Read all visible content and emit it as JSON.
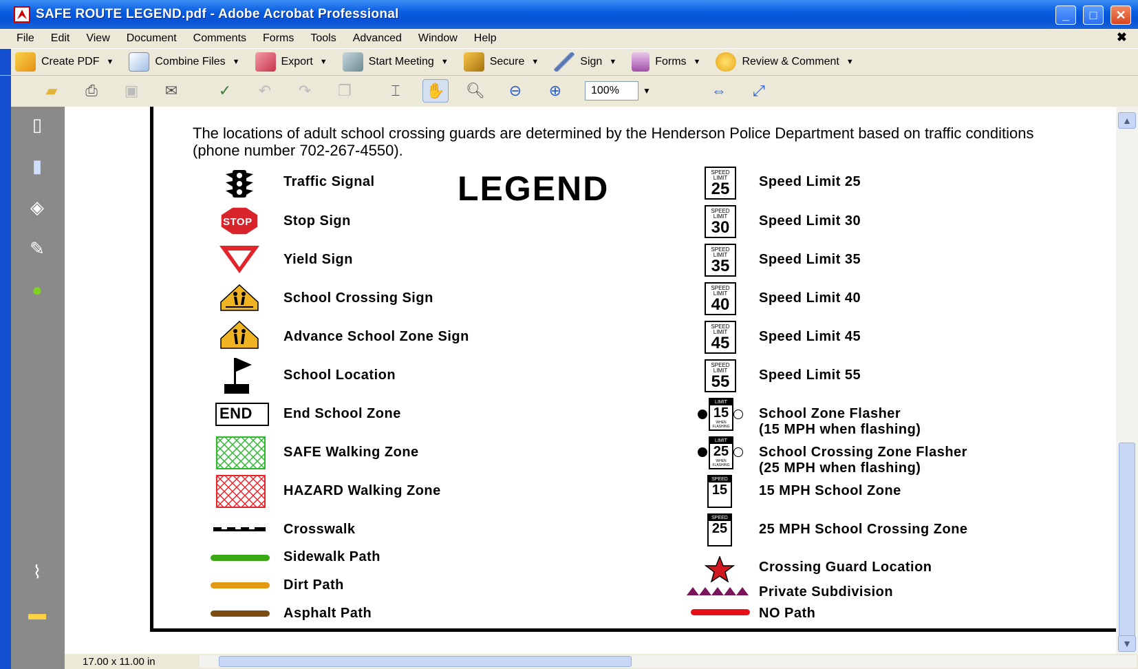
{
  "window": {
    "title": "SAFE ROUTE LEGEND.pdf - Adobe Acrobat Professional",
    "controls": {
      "minimize": "_",
      "maximize": "□",
      "close": "✕"
    }
  },
  "menu": [
    "File",
    "Edit",
    "View",
    "Document",
    "Comments",
    "Forms",
    "Tools",
    "Advanced",
    "Window",
    "Help"
  ],
  "menu_close": "✖",
  "tasks_toolbar": [
    {
      "label": "Create PDF",
      "icon": "create-pdf-icon"
    },
    {
      "label": "Combine Files",
      "icon": "combine-files-icon"
    },
    {
      "label": "Export",
      "icon": "export-icon"
    },
    {
      "label": "Start Meeting",
      "icon": "start-meeting-icon"
    },
    {
      "label": "Secure",
      "icon": "lock-icon"
    },
    {
      "label": "Sign",
      "icon": "pen-icon"
    },
    {
      "label": "Forms",
      "icon": "forms-icon"
    },
    {
      "label": "Review & Comment",
      "icon": "comment-cloud-icon"
    }
  ],
  "zoom": "100%",
  "document": {
    "intro": "The locations of adult school crossing guards are determined by the Henderson Police Department based on traffic conditions (phone number 702-267-4550).",
    "legend_title": "LEGEND",
    "left_items": [
      {
        "label": "Traffic Signal",
        "icon": "traffic-signal-icon"
      },
      {
        "label": "Stop Sign",
        "icon": "stop-sign-icon",
        "sign_text": "STOP"
      },
      {
        "label": "Yield Sign",
        "icon": "yield-sign-icon"
      },
      {
        "label": "School Crossing Sign",
        "icon": "school-crossing-sign-icon"
      },
      {
        "label": "Advance School Zone Sign",
        "icon": "advance-school-zone-sign-icon"
      },
      {
        "label": "School Location",
        "icon": "school-flag-icon"
      },
      {
        "label": "End School Zone",
        "icon": "end-school-zone-icon",
        "sign_text": "END"
      },
      {
        "label": "SAFE Walking Zone",
        "icon": "safe-zone-hatch-icon",
        "color": "#2fb82f"
      },
      {
        "label": "HAZARD Walking Zone",
        "icon": "hazard-zone-hatch-icon",
        "color": "#e8242a"
      },
      {
        "label": "Crosswalk",
        "icon": "crosswalk-icon"
      },
      {
        "label": "Sidewalk Path",
        "icon": "sidewalk-path-line",
        "color": "#3aa815"
      },
      {
        "label": "Dirt Path",
        "icon": "dirt-path-line",
        "color": "#e39a12"
      },
      {
        "label": "Asphalt Path",
        "icon": "asphalt-path-line",
        "color": "#7a4c10"
      }
    ],
    "right_items": [
      {
        "label": "Speed Limit 25",
        "sign_top": "SPEED LIMIT",
        "sign_num": "25"
      },
      {
        "label": "Speed Limit 30",
        "sign_top": "SPEED LIMIT",
        "sign_num": "30"
      },
      {
        "label": "Speed Limit 35",
        "sign_top": "SPEED LIMIT",
        "sign_num": "35"
      },
      {
        "label": "Speed Limit 40",
        "sign_top": "SPEED LIMIT",
        "sign_num": "40"
      },
      {
        "label": "Speed Limit 45",
        "sign_top": "SPEED LIMIT",
        "sign_num": "45"
      },
      {
        "label": "Speed Limit 55",
        "sign_top": "SPEED LIMIT",
        "sign_num": "55"
      },
      {
        "label": "School Zone Flasher",
        "label2": "(15 MPH when flashing)",
        "sign_top": "LIMIT",
        "sign_num": "15",
        "sign_bot": "WHEN FLASHING"
      },
      {
        "label": "School Crossing Zone Flasher",
        "label2": "(25 MPH when flashing)",
        "sign_top": "LIMIT",
        "sign_num": "25",
        "sign_bot": "WHEN FLASHING"
      },
      {
        "label": "15 MPH School Zone",
        "sign_top": "SPEED LIMIT",
        "sign_num": "15"
      },
      {
        "label": "25 MPH School Crossing Zone",
        "sign_top": "SPEED LIMIT",
        "sign_num": "25"
      },
      {
        "label": "Crossing Guard Location",
        "icon": "star-icon",
        "color": "#d0181e"
      },
      {
        "label": "Private Subdivision",
        "icon": "triangle-row-icon",
        "color": "#7a145a"
      },
      {
        "label": "NO Path",
        "icon": "no-path-line",
        "color": "#e5101a"
      }
    ]
  },
  "status": {
    "page_size": "17.00 x 11.00 in"
  }
}
